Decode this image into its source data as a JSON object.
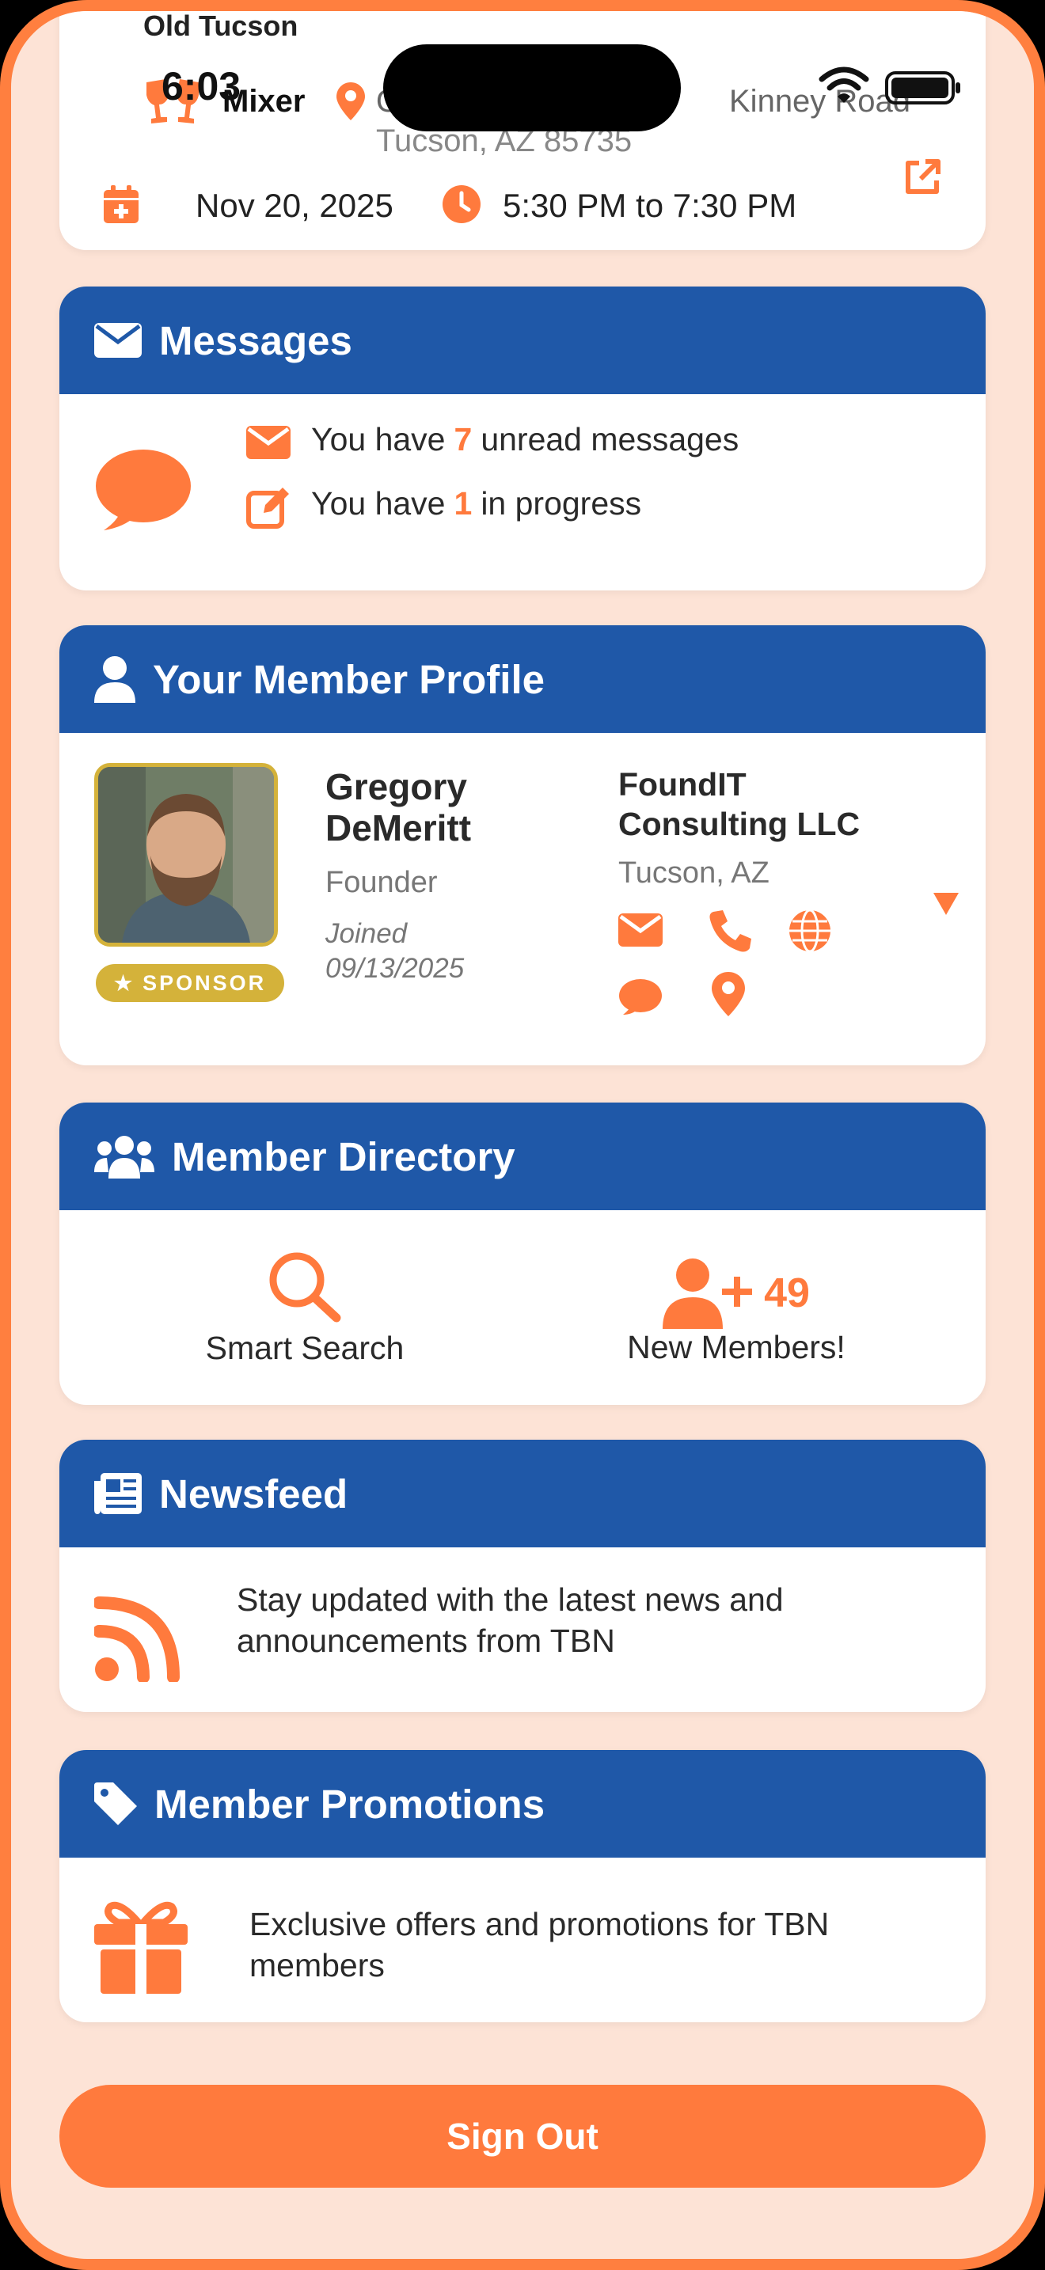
{
  "status_bar": {
    "time": "6:03"
  },
  "event": {
    "name": "Old Tucson",
    "type": "Mixer",
    "address_line1_part1": "Old",
    "address_line1_part2": "Kinney Road",
    "address_line2": "Tucson, AZ 85735",
    "date": "Nov 20, 2025",
    "time_range": "5:30 PM to 7:30 PM"
  },
  "messages": {
    "title": "Messages",
    "unread_prefix": "You have",
    "unread_count": "7",
    "unread_suffix": "unread messages",
    "progress_prefix": "You have",
    "progress_count": "1",
    "progress_suffix": "in progress"
  },
  "profile": {
    "title": "Your Member Profile",
    "badge": "SPONSOR",
    "name": "Gregory DeMeritt",
    "role": "Founder",
    "joined": "Joined 09/13/2025",
    "company": "FoundIT Consulting LLC",
    "location": "Tucson, AZ"
  },
  "directory": {
    "title": "Member Directory",
    "search_label": "Smart Search",
    "new_count": "49",
    "new_label": "New Members!"
  },
  "newsfeed": {
    "title": "Newsfeed",
    "text": "Stay updated with the latest news and announcements from TBN"
  },
  "promotions": {
    "title": "Member Promotions",
    "text": "Exclusive offers and promotions for TBN members"
  },
  "signout_label": "Sign Out",
  "colors": {
    "brand_blue": "#1f58a8",
    "accent_orange": "#ff7a3d",
    "sponsor_gold": "#d4b23a",
    "background": "#fde3d6"
  }
}
